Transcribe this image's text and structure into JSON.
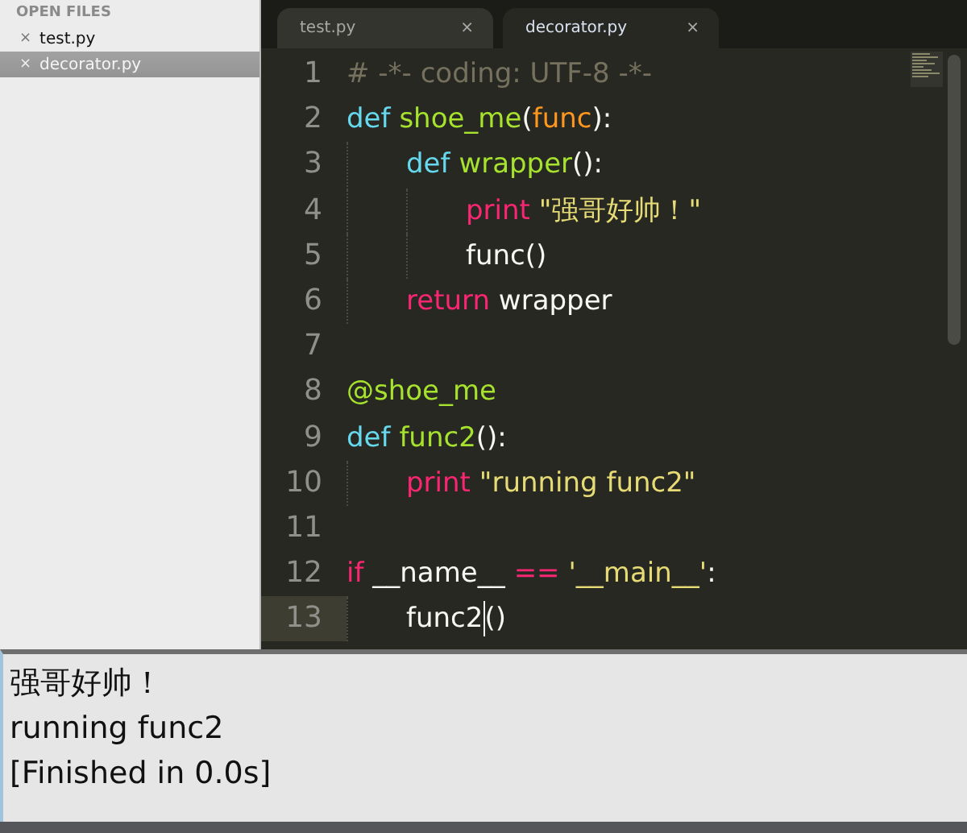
{
  "sidebar": {
    "header": "OPEN FILES",
    "files": [
      {
        "name": "test.py",
        "close": "×",
        "selected": false
      },
      {
        "name": "decorator.py",
        "close": "×",
        "selected": true
      }
    ]
  },
  "tabs": [
    {
      "label": "test.py",
      "close": "×",
      "selected": false
    },
    {
      "label": "decorator.py",
      "close": "×",
      "selected": true
    }
  ],
  "code_lines": [
    {
      "number": "1",
      "current": false,
      "tokens": [
        {
          "kind": "comment",
          "text": "# -*- coding: UTF-8 -*-"
        }
      ]
    },
    {
      "number": "2",
      "current": false,
      "tokens": [
        {
          "kind": "keyword",
          "text": "def"
        },
        {
          "kind": "name",
          "text": "shoe_me",
          "space_before": true
        },
        {
          "kind": "plain",
          "text": "("
        },
        {
          "kind": "param",
          "text": "func"
        },
        {
          "kind": "plain",
          "text": "):"
        }
      ],
      "children": [
        {
          "number": "3",
          "current": false,
          "tokens": [
            {
              "kind": "keyword",
              "text": "def"
            },
            {
              "kind": "name",
              "text": "wrapper",
              "space_before": true
            },
            {
              "kind": "plain",
              "text": "():"
            }
          ],
          "children": [
            {
              "number": "4",
              "current": false,
              "tokens": [
                {
                  "kind": "control",
                  "text": "print"
                },
                {
                  "kind": "string",
                  "text": "\"强哥好帅！\"",
                  "space_before": true
                }
              ]
            },
            {
              "number": "5",
              "current": false,
              "tokens": [
                {
                  "kind": "plain",
                  "text": "func()"
                }
              ]
            }
          ]
        },
        {
          "number": "6",
          "current": false,
          "tokens": [
            {
              "kind": "control",
              "text": "return"
            },
            {
              "kind": "plain",
              "text": "wrapper",
              "space_before": true
            }
          ]
        }
      ]
    },
    {
      "number": "7",
      "current": false
    },
    {
      "number": "8",
      "current": false,
      "tokens": [
        {
          "kind": "name",
          "text": "@shoe_me"
        }
      ]
    },
    {
      "number": "9",
      "current": false,
      "tokens": [
        {
          "kind": "keyword",
          "text": "def"
        },
        {
          "kind": "name",
          "text": "func2",
          "space_before": true
        },
        {
          "kind": "plain",
          "text": "():"
        }
      ],
      "children": [
        {
          "number": "10",
          "current": false,
          "tokens": [
            {
              "kind": "control",
              "text": "print"
            },
            {
              "kind": "string",
              "text": "\"running func2\"",
              "space_before": true
            }
          ]
        }
      ]
    },
    {
      "number": "11",
      "current": false
    },
    {
      "number": "12",
      "current": false,
      "tokens": [
        {
          "kind": "control",
          "text": "if"
        },
        {
          "kind": "plain",
          "text": "__name__",
          "space_before": true
        },
        {
          "kind": "control",
          "text": "==",
          "space_before": true
        },
        {
          "kind": "string",
          "text": "'__main__'",
          "space_before": true
        },
        {
          "kind": "plain",
          "text": ":"
        }
      ],
      "children": [
        {
          "number": "13",
          "current": true,
          "tokens": [
            {
              "kind": "plain",
              "text": "func2"
            },
            {
              "kind": "plain",
              "text": "()",
              "cursor_before": true
            }
          ]
        }
      ]
    }
  ],
  "output": [
    "强哥好帅！",
    "running func2",
    "[Finished in 0.0s]"
  ]
}
